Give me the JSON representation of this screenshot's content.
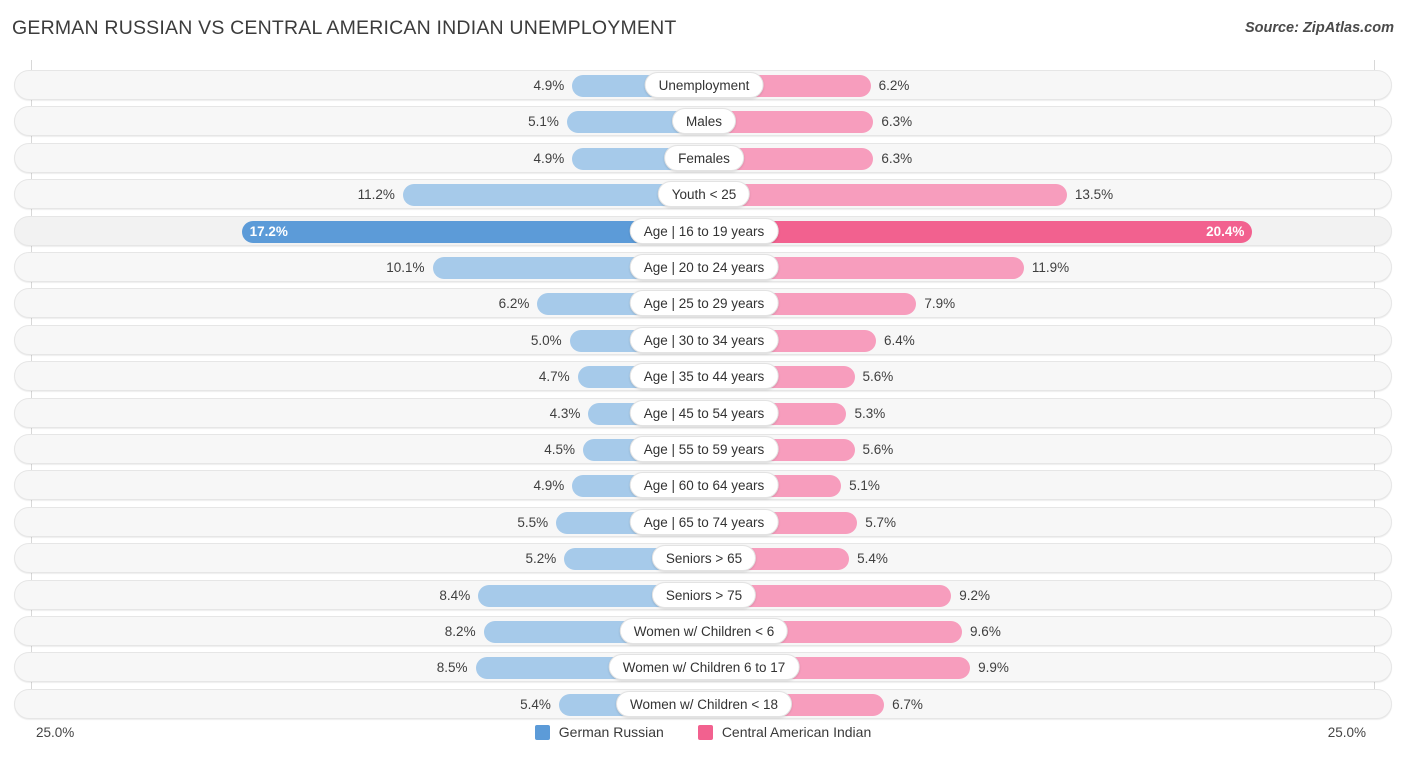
{
  "header": {
    "title": "GERMAN RUSSIAN VS CENTRAL AMERICAN INDIAN UNEMPLOYMENT",
    "source": "Source: ZipAtlas.com"
  },
  "footer": {
    "axis_left": "25.0%",
    "axis_right": "25.0%"
  },
  "legend": {
    "items": [
      {
        "label": "German Russian",
        "color": "#5c9bd8"
      },
      {
        "label": "Central American Indian",
        "color": "#f2618f"
      }
    ]
  },
  "colors": {
    "left_bar": "#a6caea",
    "right_bar": "#f79dbd",
    "left_bar_highlight": "#5c9bd8",
    "right_bar_highlight": "#f2618f",
    "row_track": "#f7f7f7",
    "row_border": "#e6e6e6"
  },
  "chart_data": {
    "type": "bar",
    "subtype": "diverging-horizontal",
    "title": "GERMAN RUSSIAN VS CENTRAL AMERICAN INDIAN UNEMPLOYMENT",
    "xlabel": "",
    "ylabel": "",
    "xlim": [
      25.0,
      25.0
    ],
    "axis_unit": "%",
    "grid": false,
    "legend_position": "bottom-center",
    "categories": [
      "Unemployment",
      "Males",
      "Females",
      "Youth < 25",
      "Age | 16 to 19 years",
      "Age | 20 to 24 years",
      "Age | 25 to 29 years",
      "Age | 30 to 34 years",
      "Age | 35 to 44 years",
      "Age | 45 to 54 years",
      "Age | 55 to 59 years",
      "Age | 60 to 64 years",
      "Age | 65 to 74 years",
      "Seniors > 65",
      "Seniors > 75",
      "Women w/ Children < 6",
      "Women w/ Children 6 to 17",
      "Women w/ Children < 18"
    ],
    "series": [
      {
        "name": "German Russian",
        "side": "left",
        "color": "#a6caea",
        "values": [
          4.9,
          5.1,
          4.9,
          11.2,
          17.2,
          10.1,
          6.2,
          5.0,
          4.7,
          4.3,
          4.5,
          4.9,
          5.5,
          5.2,
          8.4,
          8.2,
          8.5,
          5.4
        ],
        "labels": [
          "4.9%",
          "5.1%",
          "4.9%",
          "11.2%",
          "17.2%",
          "10.1%",
          "6.2%",
          "5.0%",
          "4.7%",
          "4.3%",
          "4.5%",
          "4.9%",
          "5.5%",
          "5.2%",
          "8.4%",
          "8.2%",
          "8.5%",
          "5.4%"
        ]
      },
      {
        "name": "Central American Indian",
        "side": "right",
        "color": "#f79dbd",
        "values": [
          6.2,
          6.3,
          6.3,
          13.5,
          20.4,
          11.9,
          7.9,
          6.4,
          5.6,
          5.3,
          5.6,
          5.1,
          5.7,
          5.4,
          9.2,
          9.6,
          9.9,
          6.7
        ],
        "labels": [
          "6.2%",
          "6.3%",
          "6.3%",
          "13.5%",
          "20.4%",
          "11.9%",
          "7.9%",
          "6.4%",
          "5.6%",
          "5.3%",
          "5.6%",
          "5.1%",
          "5.7%",
          "5.4%",
          "9.2%",
          "9.6%",
          "9.9%",
          "6.7%"
        ]
      }
    ],
    "highlighted_row_index": 4
  }
}
